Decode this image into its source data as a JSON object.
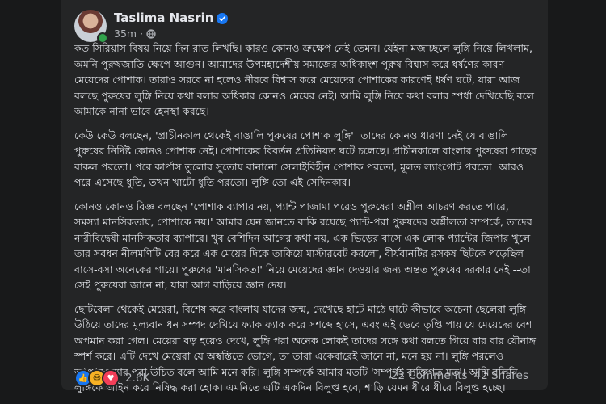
{
  "post": {
    "author": "Taslima Nasrin",
    "time": "35m",
    "paragraphs": [
      "কত সিরিয়াস বিষয় নিয়ে দিন রাত লিখছি। কারও কোনও ভ্রুক্ষেপ নেই তেমন। যেইনা মজাচ্ছলে লুঙ্গি নিয়ে লিখলাম, অমনি পুরুষজাতি ক্ষেপে আগুন। আমাদের উপমহাদেশীয় সমাজের অধিকাংশ পুরুষ বিশ্বাস করে ধর্ষণের কারণ মেয়েদের পোশাক। তারাও সরবে না হলেও নীরবে বিশ্বাস করে মেয়েদের পোশাকের কারণেই ধর্ষণ ঘটে, যারা আজ বলছে পুরুষের লুঙ্গি নিয়ে কথা বলার অধিকার কোনও মেয়ের নেই। আমি লুঙ্গি নিয়ে কথা বলার স্পর্ধা দেখিয়েছি বলে আমাকে নানা ভাবে হেনস্থা করছে।",
      "কেউ কেউ বলছেন, 'প্রাচীনকাল থেকেই বাঙালি পুরুষের পোশাক লুঙ্গি'। তাদের কোনও ধারণা নেই যে বাঙালি পুরুষের নির্দিষ্ট কোনও পোশাক নেই। পোশাকের বিবর্তন প্রতিনিয়ত ঘটে চলেছে। প্রাচীনকালে বাংলার পুরুষেরা গাছের বাকল পরতো। পরে কার্পাস তুলোর সুতোয় বানানো সেলাইবিহীন পোশাক পরতো, মূলত ল্যাংগোট পরতো। আরও পরে এসেছে ধুতি, তখন খাটো ধুতি পরতো। লুঙ্গি তো এই সেদিনকার।",
      "কোনও কোনও বিজ্ঞ বলছেন 'পোশাক ব্যাপার নয়, প্যান্ট পাজামা পরেও পুরুষেরা অশ্লীল আচরণ করতে পারে, সমস্যা মানসিকতায়, পোশাকে নয়।' আমার যেন জানতে বাকি রয়েছে প্যান্ট-পরা পুরুষদের অশ্লীলতা সম্পর্কে, তাদের নারীবিদ্বেষী মানসিকতার ব্যাপারে। খুব বেশিদিন আগের কথা নয়, এক ভিড়ের বাসে এক লোক প্যান্টের জিপার খুলে তার সবধন নীলমণিটি বের করে এক মেয়ের দিকে তাকিয়ে মাস্টারবেট করলো, বীর্যবানটির রসকষ ছিটকে পড়েছিল বাসে-বসা অনেকের গায়ে। পুরুষের 'মানসিকতা' নিয়ে মেয়েদের জ্ঞান দেওয়ার জন্য অন্তত পুরুষের দরকার নেই --তা সেই পুরুষেরা জানে না, যারা আগ বাড়িয়ে জ্ঞান দেয়।",
      "ছোটবেলা থেকেই মেয়েরা, বিশেষ করে বাংলায় যাদের জন্ম, দেখেছে হাটে মাঠে ঘাটে কীভাবে অচেনা ছেলেরা লুঙ্গি উঠিয়ে তাদের মূল্যবান ধন সম্পদ দেখিয়ে ফ্যাক ফ্যাক করে সশব্দে হাসে, এবং এই ভেবে তৃপ্তি পায় যে মেয়েদের বেশ অপমান করা গেল। মেয়েরা বড় হয়েও দেখে, লুঙ্গি পরা অনেক লোকই তাদের সঙ্গে কথা বলতে গিয়ে বার বার যৌনাঙ্গ স্পর্শ করে। এটি দেখে মেয়েরা যে অস্বস্তিতে ভোগে, তা তারা একেবারেই জানে না, মনে হয় না। লুঙ্গি পরলেও আণ্ডারওয়্যার পরা উচিত বলে আমি মনে করি। লুঙ্গি সম্পর্কে আমার মতটি 'সম্পূর্ণই ব্যক্তিগত মত'। আমি বলিনি লুঙ্গিকে আইন করে নিষিদ্ধ করা হোক। এমনিতে এটি একদিন বিলুপ্ত হবে, শাড়ি যেমন ধীরে ধীরে বিলুপ্ত হচ্ছে।"
    ]
  },
  "footer": {
    "reaction_count": "2.6K",
    "comments": "22 Comments",
    "shares": "42 Shares"
  },
  "icons": {
    "verified": "verified-badge-icon",
    "privacy": "globe-icon",
    "reactions": [
      "like-icon",
      "haha-icon",
      "love-icon"
    ]
  },
  "colors": {
    "background": "#18191a",
    "card": "#242526",
    "text": "#e4e6eb",
    "secondary_text": "#b0b3b8",
    "verified": "#1877f2",
    "online": "#31a24c"
  }
}
